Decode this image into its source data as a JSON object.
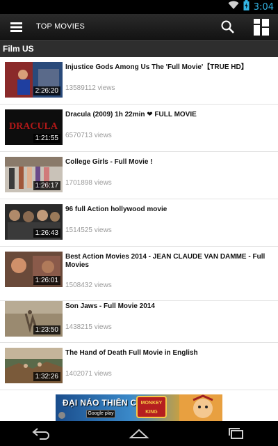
{
  "status_bar": {
    "time": "3:04",
    "icons": [
      "wifi-icon",
      "battery-icon"
    ]
  },
  "action_bar": {
    "title": "TOP MOVIES",
    "menu_icon": "menu-icon",
    "search_icon": "search-icon",
    "view_toggle_icon": "grid-view-icon"
  },
  "section": {
    "title": "Film US"
  },
  "videos": [
    {
      "title": "Injustice Gods Among Us The 'Full Movie'【TRUE HD】",
      "views": "13589112 views",
      "duration": "2:26:20"
    },
    {
      "title": "Dracula (2009) 1h 22min ❤ FULL MOVIE",
      "views": "6570713 views",
      "duration": "1:21:55",
      "thumb_text": "DRACULA"
    },
    {
      "title": "College Girls - Full Movie !",
      "views": "1701898 views",
      "duration": "1:26:17"
    },
    {
      "title": "96 full Action hollywood movie",
      "views": "1514525 views",
      "duration": "1:26:43"
    },
    {
      "title": "Best Action Movies 2014 - JEAN CLAUDE VAN DAMME - Full Movies",
      "views": "1508432 views",
      "duration": "1:26:01"
    },
    {
      "title": "Son Jaws - Full Movie 2014",
      "views": "1438215 views",
      "duration": "1:23:50"
    },
    {
      "title": "The Hand of Death Full Movie in English",
      "views": "1402071 views",
      "duration": "1:32:26"
    }
  ],
  "ad": {
    "text": "ĐẠI NÁO THIÊN CUNG",
    "store_label": "Google play",
    "logo_text": "MONKEY KING"
  },
  "nav_bar": {
    "icons": [
      "back-icon",
      "home-icon",
      "recent-apps-icon"
    ]
  },
  "colors": {
    "accent_blue": "#33b5e5",
    "action_bar": "#1e1e1e",
    "section_header": "#2e2e2e",
    "views_gray": "#9a9a9a"
  }
}
